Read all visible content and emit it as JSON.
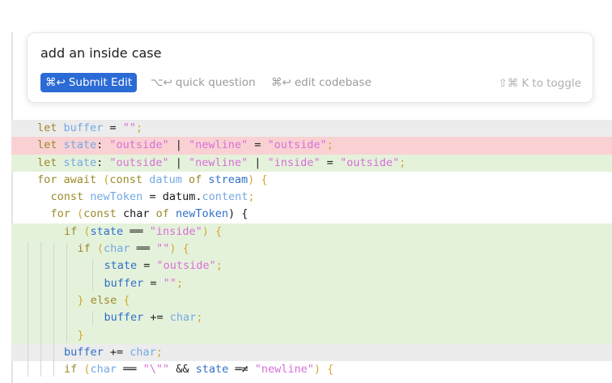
{
  "prompt": {
    "text": "add an inside case",
    "submit_shortcut": "⌘↩",
    "submit_label": "Submit Edit",
    "quick_shortcut": "⌥↩",
    "quick_label": "quick question",
    "codebase_shortcut": "⌘↩",
    "codebase_label": "edit codebase",
    "toggle_shortcut": "⇧⌘ K",
    "toggle_label": "to toggle"
  },
  "code_lines": [
    {
      "bg": "gray",
      "indent": 0,
      "tokens": [
        [
          "kw",
          "let "
        ],
        [
          "var",
          "buffer"
        ],
        [
          "op",
          " = "
        ],
        [
          "str",
          "\"\""
        ],
        [
          "punc",
          ";"
        ]
      ]
    },
    {
      "bg": "red",
      "indent": 0,
      "tokens": [
        [
          "kw",
          "let "
        ],
        [
          "var",
          "state"
        ],
        [
          "op",
          ": "
        ],
        [
          "str",
          "\"outside\""
        ],
        [
          "op",
          " | "
        ],
        [
          "str",
          "\"newline\""
        ],
        [
          "op",
          " = "
        ],
        [
          "str",
          "\"outside\""
        ],
        [
          "punc",
          ";"
        ]
      ]
    },
    {
      "bg": "green",
      "indent": 0,
      "tokens": [
        [
          "kw",
          "let "
        ],
        [
          "var",
          "state"
        ],
        [
          "op",
          ": "
        ],
        [
          "str",
          "\"outside\""
        ],
        [
          "op",
          " | "
        ],
        [
          "str",
          "\"newline\""
        ],
        [
          "op",
          " | "
        ],
        [
          "str",
          "\"inside\""
        ],
        [
          "op",
          " = "
        ],
        [
          "str",
          "\"outside\""
        ],
        [
          "punc",
          ";"
        ]
      ]
    },
    {
      "bg": "none",
      "indent": 0,
      "tokens": [
        [
          "kw",
          "for await "
        ],
        [
          "punc",
          "("
        ],
        [
          "kw",
          "const "
        ],
        [
          "var",
          "datum "
        ],
        [
          "kw",
          "of "
        ],
        [
          "id",
          "stream"
        ],
        [
          "punc",
          ") {"
        ]
      ]
    },
    {
      "bg": "none",
      "indent": 1,
      "tokens": [
        [
          "kw",
          "const "
        ],
        [
          "var",
          "newToken"
        ],
        [
          "op",
          " = "
        ],
        [
          "plain",
          "datum."
        ],
        [
          "var",
          "content"
        ],
        [
          "punc",
          ";"
        ]
      ]
    },
    {
      "bg": "none",
      "indent": 1,
      "tokens": [
        [
          "kw",
          "for "
        ],
        [
          "punc",
          "("
        ],
        [
          "kw",
          "const "
        ],
        [
          "plain",
          "char "
        ],
        [
          "kw",
          "of "
        ],
        [
          "id",
          "newToken"
        ],
        [
          "plain",
          ") {"
        ]
      ]
    },
    {
      "bg": "green",
      "indent": 2,
      "tokens": [
        [
          "kw",
          "if "
        ],
        [
          "punc",
          "("
        ],
        [
          "id",
          "state"
        ],
        [
          "op",
          " ══ "
        ],
        [
          "str",
          "\"inside\""
        ],
        [
          "punc",
          ") {"
        ]
      ]
    },
    {
      "bg": "green",
      "indent": 3,
      "tokens": [
        [
          "kw",
          "if "
        ],
        [
          "punc",
          "("
        ],
        [
          "var",
          "char"
        ],
        [
          "op",
          " ══ "
        ],
        [
          "str",
          "\"\""
        ],
        [
          "punc",
          ") {"
        ]
      ]
    },
    {
      "bg": "green",
      "indent": 5,
      "tokens": [
        [
          "id",
          "state"
        ],
        [
          "op",
          " = "
        ],
        [
          "str",
          "\"outside\""
        ],
        [
          "punc",
          ";"
        ]
      ]
    },
    {
      "bg": "green",
      "indent": 5,
      "tokens": [
        [
          "id",
          "buffer"
        ],
        [
          "op",
          " = "
        ],
        [
          "str",
          "\"\""
        ],
        [
          "punc",
          ";"
        ]
      ]
    },
    {
      "bg": "green",
      "indent": 3,
      "tokens": [
        [
          "punc",
          "} "
        ],
        [
          "kw",
          "else "
        ],
        [
          "punc",
          "{"
        ]
      ]
    },
    {
      "bg": "green",
      "indent": 5,
      "tokens": [
        [
          "id",
          "buffer"
        ],
        [
          "op",
          " += "
        ],
        [
          "var",
          "char"
        ],
        [
          "punc",
          ";"
        ]
      ]
    },
    {
      "bg": "green",
      "indent": 3,
      "tokens": [
        [
          "punc",
          "}"
        ]
      ]
    },
    {
      "bg": "gray",
      "indent": 2,
      "tokens": [
        [
          "id",
          "buffer"
        ],
        [
          "op",
          " += "
        ],
        [
          "var",
          "char"
        ],
        [
          "punc",
          ";"
        ]
      ]
    },
    {
      "bg": "none",
      "indent": 2,
      "tokens": [
        [
          "kw",
          "if "
        ],
        [
          "punc",
          "("
        ],
        [
          "var",
          "char"
        ],
        [
          "op",
          " ══ "
        ],
        [
          "str",
          "\"\\\"\""
        ],
        [
          "op",
          " && "
        ],
        [
          "id",
          "state"
        ],
        [
          "op",
          " ═≠ "
        ],
        [
          "str",
          "\"newline\""
        ],
        [
          "punc",
          ") {"
        ]
      ]
    }
  ]
}
